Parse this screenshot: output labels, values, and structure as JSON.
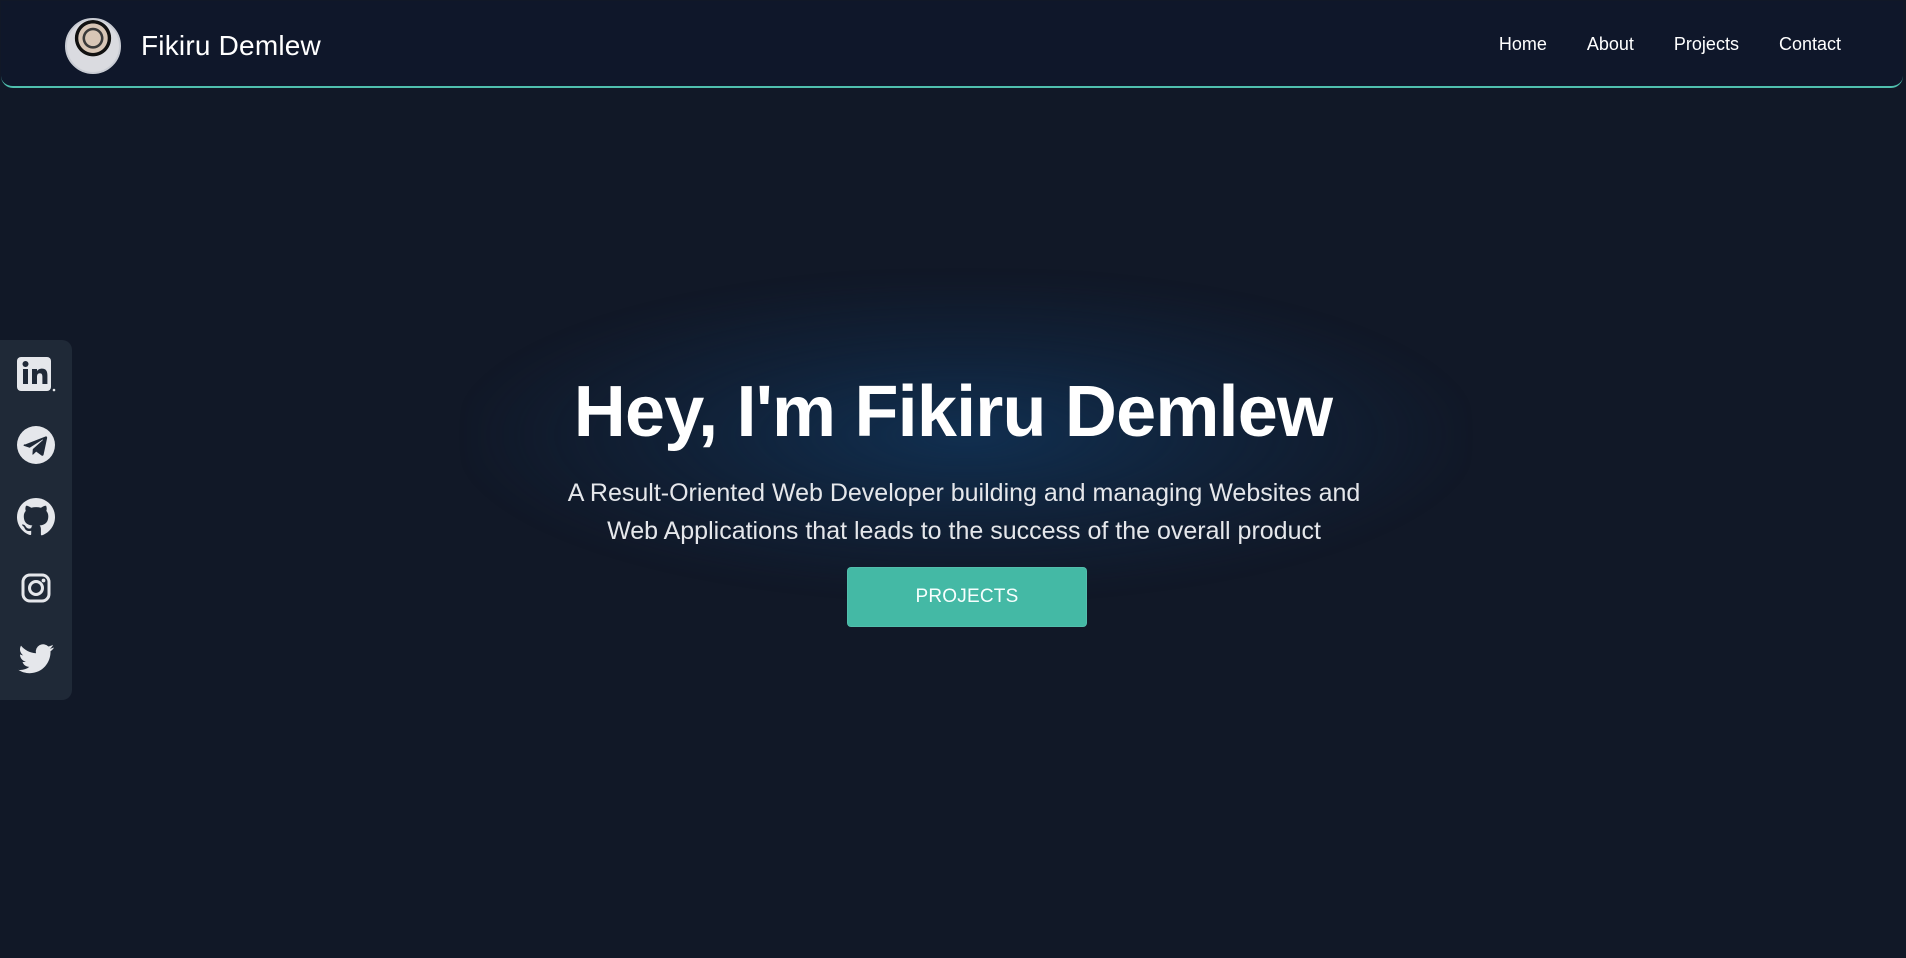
{
  "header": {
    "brand_name": "Fikiru Demlew",
    "nav": [
      {
        "label": "Home"
      },
      {
        "label": "About"
      },
      {
        "label": "Projects"
      },
      {
        "label": "Contact"
      }
    ]
  },
  "sidebar": {
    "social_links": [
      {
        "icon": "linkedin-icon"
      },
      {
        "icon": "telegram-icon"
      },
      {
        "icon": "github-icon"
      },
      {
        "icon": "instagram-icon"
      },
      {
        "icon": "twitter-icon"
      }
    ]
  },
  "hero": {
    "title": "Hey, I'm Fikiru Demlew",
    "subtitle": "A Result-Oriented Web Developer building and managing Websites and Web Applications that leads to the success of the overall product",
    "button_label": "PROJECTS"
  },
  "colors": {
    "background": "#111827",
    "navbar_background": "#0f172a",
    "accent": "#44b9a5",
    "sidebar_background": "#1f2937"
  }
}
